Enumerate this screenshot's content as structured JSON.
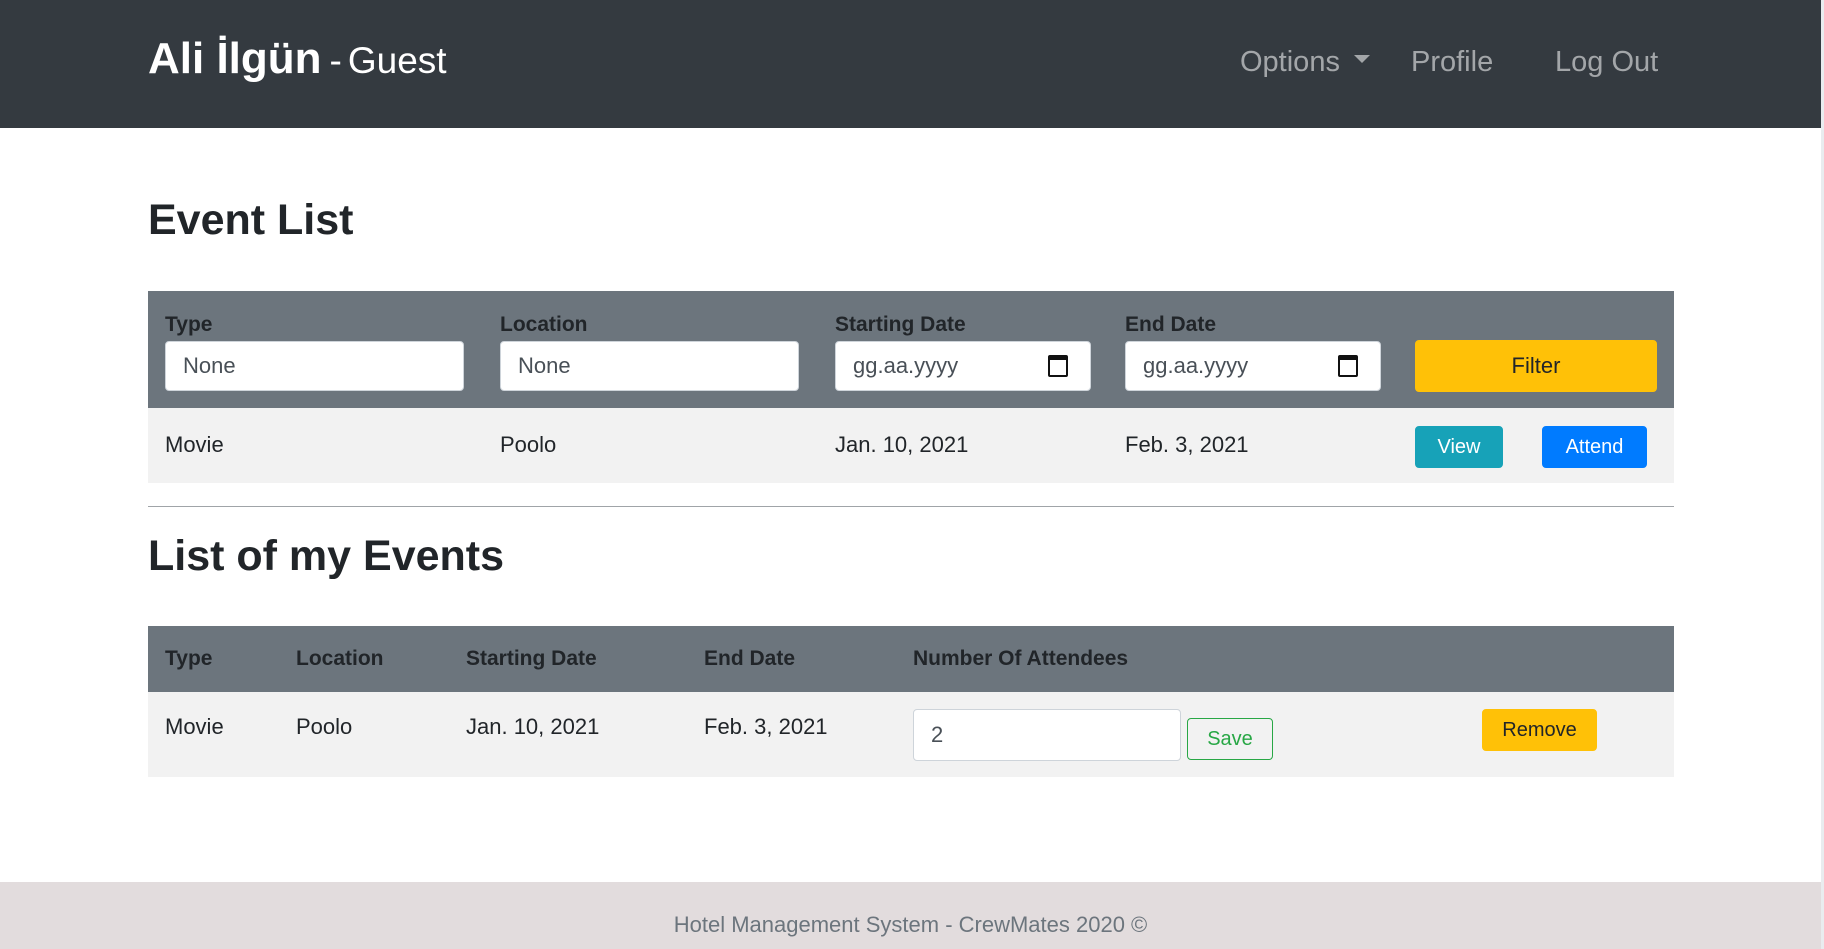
{
  "navbar": {
    "user_name": "Ali İlgün",
    "separator": "-",
    "role": "Guest",
    "links": {
      "options": "Options",
      "profile": "Profile",
      "logout": "Log Out"
    }
  },
  "event_list": {
    "title": "Event List",
    "filters": {
      "type_label": "Type",
      "type_value": "None",
      "location_label": "Location",
      "location_value": "None",
      "start_label": "Starting Date",
      "start_placeholder": "gg.aa.yyyy",
      "end_label": "End Date",
      "end_placeholder": "gg.aa.yyyy",
      "filter_button": "Filter"
    },
    "rows": [
      {
        "type": "Movie",
        "location": "Poolo",
        "start": "Jan. 10, 2021",
        "end": "Feb. 3, 2021",
        "view_button": "View",
        "attend_button": "Attend"
      }
    ]
  },
  "my_events": {
    "title": "List of my Events",
    "columns": {
      "type": "Type",
      "location": "Location",
      "start": "Starting Date",
      "end": "End Date",
      "attendees": "Number Of Attendees"
    },
    "rows": [
      {
        "type": "Movie",
        "location": "Poolo",
        "start": "Jan. 10, 2021",
        "end": "Feb. 3, 2021",
        "attendees": "2",
        "save_button": "Save",
        "remove_button": "Remove"
      }
    ]
  },
  "footer": {
    "text": "Hotel Management System - CrewMates 2020 ©"
  },
  "colors": {
    "navbar": "#343a40",
    "table_header": "#6c757d",
    "row": "#f2f2f2",
    "warning": "#ffc107",
    "info": "#17a2b8",
    "primary": "#007bff",
    "success": "#28a745",
    "footer": "#e2dcdd"
  }
}
